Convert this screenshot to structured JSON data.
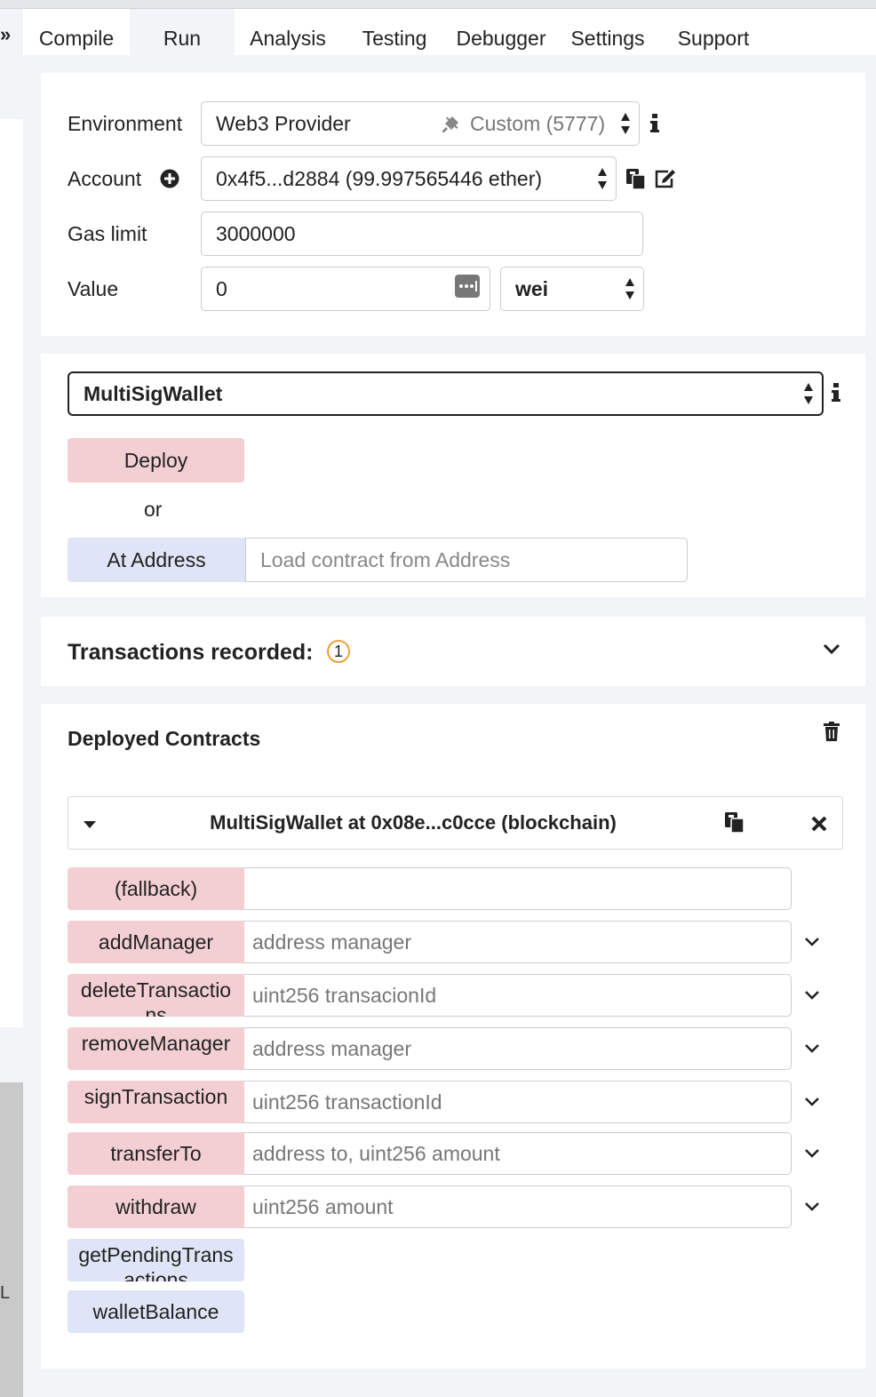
{
  "tabs": [
    "Compile",
    "Run",
    "Analysis",
    "Testing",
    "Debugger",
    "Settings",
    "Support"
  ],
  "active_tab": "Run",
  "env": {
    "environment_label": "Environment",
    "environment_value": "Web3 Provider",
    "environment_network": "Custom (5777)",
    "account_label": "Account",
    "account_value": "0x4f5...d2884 (99.997565446 ether)",
    "gas_label": "Gas limit",
    "gas_value": "3000000",
    "value_label": "Value",
    "value_value": "0",
    "unit_value": "wei"
  },
  "contract": {
    "selected": "MultiSigWallet",
    "deploy_label": "Deploy",
    "or_label": "or",
    "at_address_label": "At Address",
    "at_address_placeholder": "Load contract from Address"
  },
  "transactions": {
    "label": "Transactions recorded:",
    "count": "1"
  },
  "deployed": {
    "title": "Deployed Contracts",
    "instance_title": "MultiSigWallet at 0x08e...c0cce (blockchain)",
    "functions": [
      {
        "name": "(fallback)",
        "placeholder": ""
      },
      {
        "name": "addManager",
        "placeholder": "address manager"
      },
      {
        "name": "deleteTransactions",
        "placeholder": "uint256 transacionId"
      },
      {
        "name": "removeManager",
        "placeholder": "address manager"
      },
      {
        "name": "signTransaction",
        "placeholder": "uint256 transactionId"
      },
      {
        "name": "transferTo",
        "placeholder": "address to, uint256 amount"
      },
      {
        "name": "withdraw",
        "placeholder": "uint256 amount"
      }
    ],
    "calls": [
      "getPendingTransactions",
      "walletBalance"
    ]
  },
  "left_char": "L",
  "colors": {
    "transact": "#f3cfd3",
    "call": "#dfe5f6",
    "badge": "#e8a33a",
    "background": "#f2f4f8"
  }
}
